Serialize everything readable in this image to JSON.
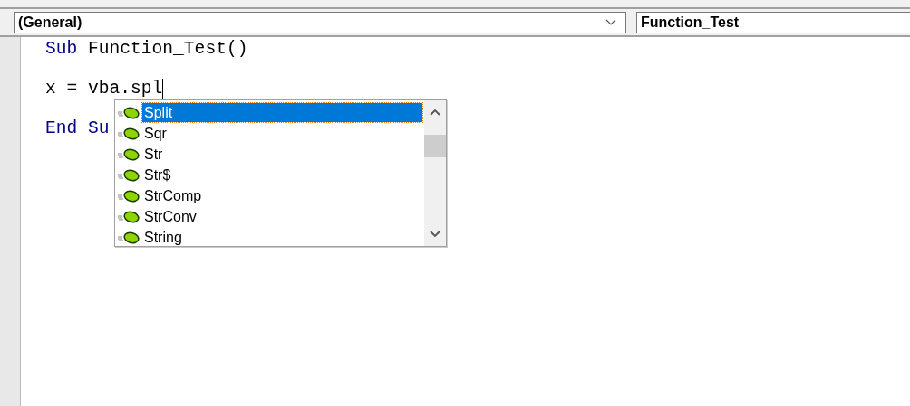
{
  "object_box": {
    "value": "(General)"
  },
  "procedure_box": {
    "value": "Function_Test"
  },
  "code_lines": [
    {
      "tokens": [
        {
          "text": "Sub",
          "kind": "keyword"
        },
        {
          "text": " Function_Test()",
          "kind": "plain"
        }
      ],
      "caret": false
    },
    {
      "caret": false
    },
    {
      "tokens": [
        {
          "text": "x = vba.spl",
          "kind": "plain"
        }
      ],
      "caret": true
    },
    {
      "caret": false
    },
    {
      "tokens": [
        {
          "text": "End Su",
          "kind": "keyword"
        }
      ],
      "caret": false
    }
  ],
  "completion_list": [
    {
      "label": "Split",
      "selected": true
    },
    {
      "label": "Sqr",
      "selected": false
    },
    {
      "label": "Str",
      "selected": false
    },
    {
      "label": "Str$",
      "selected": false
    },
    {
      "label": "StrComp",
      "selected": false
    },
    {
      "label": "StrConv",
      "selected": false
    },
    {
      "label": "String",
      "selected": false
    }
  ]
}
